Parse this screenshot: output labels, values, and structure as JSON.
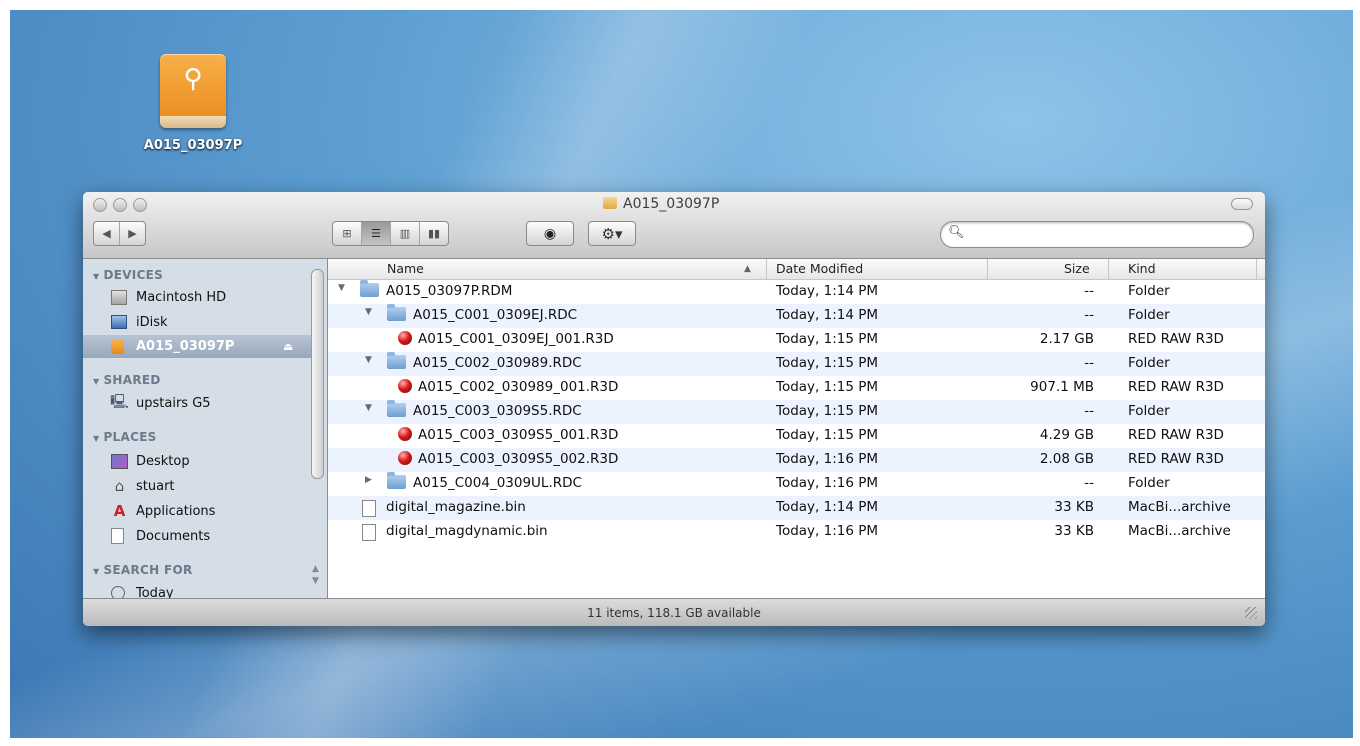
{
  "desktop": {
    "drive_label": "A015_03097P"
  },
  "window": {
    "title": "A015_03097P",
    "status": "11 items, 118.1 GB available",
    "search": {
      "value": "",
      "placeholder": ""
    }
  },
  "sidebar": {
    "sections": {
      "devices": "DEVICES",
      "shared": "SHARED",
      "places": "PLACES",
      "search_for": "SEARCH FOR"
    },
    "devices": [
      "Macintosh HD",
      "iDisk",
      "A015_03097P"
    ],
    "shared": [
      "upstairs G5"
    ],
    "places": [
      "Desktop",
      "stuart",
      "Applications",
      "Documents"
    ],
    "search_for": [
      "Today"
    ]
  },
  "columns": {
    "name": "Name",
    "date": "Date Modified",
    "size": "Size",
    "kind": "Kind"
  },
  "rows": [
    {
      "name": "A015_03097P.RDM",
      "date": "Today, 1:14 PM",
      "size": "--",
      "kind": "Folder",
      "depth": 0,
      "type": "folder",
      "disclosure": "expanded"
    },
    {
      "name": "A015_C001_0309EJ.RDC",
      "date": "Today, 1:14 PM",
      "size": "--",
      "kind": "Folder",
      "depth": 1,
      "type": "folder",
      "disclosure": "expanded"
    },
    {
      "name": "A015_C001_0309EJ_001.R3D",
      "date": "Today, 1:15 PM",
      "size": "2.17 GB",
      "kind": "RED RAW R3D",
      "depth": 2,
      "type": "r3d",
      "disclosure": "none"
    },
    {
      "name": "A015_C002_030989.RDC",
      "date": "Today, 1:15 PM",
      "size": "--",
      "kind": "Folder",
      "depth": 1,
      "type": "folder",
      "disclosure": "expanded"
    },
    {
      "name": "A015_C002_030989_001.R3D",
      "date": "Today, 1:15 PM",
      "size": "907.1 MB",
      "kind": "RED RAW R3D",
      "depth": 2,
      "type": "r3d",
      "disclosure": "none"
    },
    {
      "name": "A015_C003_0309S5.RDC",
      "date": "Today, 1:15 PM",
      "size": "--",
      "kind": "Folder",
      "depth": 1,
      "type": "folder",
      "disclosure": "expanded"
    },
    {
      "name": "A015_C003_0309S5_001.R3D",
      "date": "Today, 1:15 PM",
      "size": "4.29 GB",
      "kind": "RED RAW R3D",
      "depth": 2,
      "type": "r3d",
      "disclosure": "none"
    },
    {
      "name": "A015_C003_0309S5_002.R3D",
      "date": "Today, 1:16 PM",
      "size": "2.08 GB",
      "kind": "RED RAW R3D",
      "depth": 2,
      "type": "r3d",
      "disclosure": "none"
    },
    {
      "name": "A015_C004_0309UL.RDC",
      "date": "Today, 1:16 PM",
      "size": "--",
      "kind": "Folder",
      "depth": 1,
      "type": "folder",
      "disclosure": "collapsed"
    },
    {
      "name": "digital_magazine.bin",
      "date": "Today, 1:14 PM",
      "size": "33 KB",
      "kind": "MacBi...archive",
      "depth": 0,
      "type": "doc",
      "disclosure": "none"
    },
    {
      "name": "digital_magdynamic.bin",
      "date": "Today, 1:16 PM",
      "size": "33 KB",
      "kind": "MacBi...archive",
      "depth": 0,
      "type": "doc",
      "disclosure": "none"
    }
  ],
  "icons": {
    "back": "back-arrow-icon",
    "forward": "forward-arrow-icon",
    "view_icons": "icon-view-icon",
    "view_list": "list-view-icon",
    "view_columns": "column-view-icon",
    "view_coverflow": "cover-flow-icon",
    "quicklook": "eye-icon",
    "action": "gear-icon",
    "search": "magnifier-icon"
  }
}
